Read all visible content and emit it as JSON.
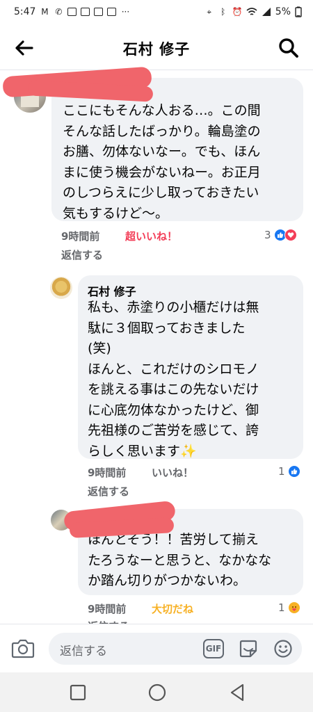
{
  "status_bar": {
    "time": "5:47",
    "battery": "5%"
  },
  "header": {
    "title": "石村 修子"
  },
  "comments": [
    {
      "text": "ここにもそんな人おる…。この間\nそんな話したばっかり。輪島塗の\nお膳、勿体ないなー。でも、ほん\nまに使う機会がないねー。お正月\nのしつらえに少し取っておきたい\n気もするけど〜。",
      "time": "9時間前",
      "reaction_label": "超いいね！",
      "reaction_color": "#f33e58",
      "reply_label": "返信する",
      "count": "3"
    },
    {
      "author": "石村 修子",
      "text": "私も、赤塗りの小櫃だけは無\n駄に３個取っておきました\n(笑)\nほんと、これだけのシロモノ\nを誂える事はこの先ないだけ\nに心底勿体なかったけど、御\n先祖様のご苦労を感じて、誇\nらしく思います✨",
      "time": "9時間前",
      "reaction_label": "いいね！",
      "reaction_color": "#65676b",
      "reply_label": "返信する",
      "count": "1"
    },
    {
      "text": "ほんとそう！！苦労して揃え\nたろうなーと思うと、なかなな\nか踏ん切りがつかないわ。",
      "time": "9時間前",
      "reaction_label": "大切だね",
      "reaction_color": "#f7b125",
      "reply_label": "返信する",
      "count": "1"
    }
  ],
  "composer": {
    "placeholder": "返信する",
    "gif_label": "GIF"
  },
  "colors": {
    "like_blue": "#1877f2",
    "love_red": "#f33e58",
    "care_yellow": "#f7b125",
    "bubble": "#f0f2f5",
    "redaction": "#f0656b"
  },
  "icons": [
    "back-arrow-icon",
    "search-icon",
    "camera-icon",
    "gif-icon",
    "sticker-icon",
    "emoji-icon",
    "like-icon",
    "love-icon",
    "care-icon",
    "sparkles-icon",
    "recent-apps-icon",
    "home-icon",
    "back-nav-icon"
  ]
}
